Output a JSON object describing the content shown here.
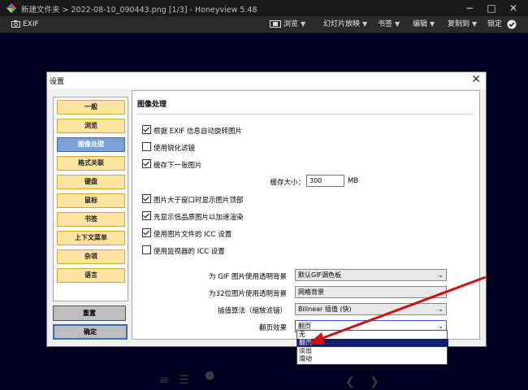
{
  "window": {
    "title": "新建文件夹 > 2022-08-10_090443.png [1/3] - Honeyview 5.48",
    "min_glyph": "−",
    "max_glyph": "□",
    "close_glyph": "✕"
  },
  "toolbar": {
    "exif_label": "EXIF",
    "menus": [
      {
        "label": "浏览"
      },
      {
        "label": "幻灯片放映"
      },
      {
        "label": "书签"
      },
      {
        "label": "编辑"
      },
      {
        "label": "复制到"
      },
      {
        "label": "锁定"
      }
    ]
  },
  "dialog": {
    "title": "设置",
    "close_glyph": "✕",
    "nav": [
      {
        "label": "一般"
      },
      {
        "label": "浏览"
      },
      {
        "label": "图像处理"
      },
      {
        "label": "格式关联"
      },
      {
        "label": "键盘"
      },
      {
        "label": "鼠标"
      },
      {
        "label": "书签"
      },
      {
        "label": "上下文菜单"
      },
      {
        "label": "杂项"
      },
      {
        "label": "语言"
      }
    ],
    "active_nav": 2,
    "reset_label": "重置",
    "ok_label": "确定",
    "section_title": "图像处理",
    "options": [
      {
        "label": "根据 EXIF 信息自动旋转图片",
        "checked": true
      },
      {
        "label": "使用锐化滤镜",
        "checked": false
      },
      {
        "label": "缓存下一张图片",
        "checked": true
      },
      {
        "label": "图片大于窗口时显示图片顶部",
        "checked": true
      },
      {
        "label": "先显示低品质图片以加速渲染",
        "checked": true
      },
      {
        "label": "使用图片文件的 ICC 设置",
        "checked": true
      },
      {
        "label": "使用监视器的 ICC 设置",
        "checked": false
      }
    ],
    "cache_label": "缓存大小：",
    "cache_value": "300",
    "cache_unit": "MB",
    "selects": [
      {
        "label": "为 GIF 图片使用透明背景",
        "value": "默认GIF调色板"
      },
      {
        "label": "为32位图片使用透明背景",
        "value": "网格背景"
      },
      {
        "label": "插值算法（缩放滤镜）",
        "value": "Bilinear 插值 (快)"
      },
      {
        "label": "翻页效果",
        "value": "翻页"
      }
    ],
    "dropdown_options": [
      "无",
      "翻页",
      "淡出",
      "滑动"
    ],
    "dropdown_highlight": 1
  },
  "colors": {
    "nav_button": "#fde5a0",
    "nav_active": "#7aa0d8",
    "dropdown_highlight": "#11206e",
    "annotation_arrow": "#d01010"
  }
}
